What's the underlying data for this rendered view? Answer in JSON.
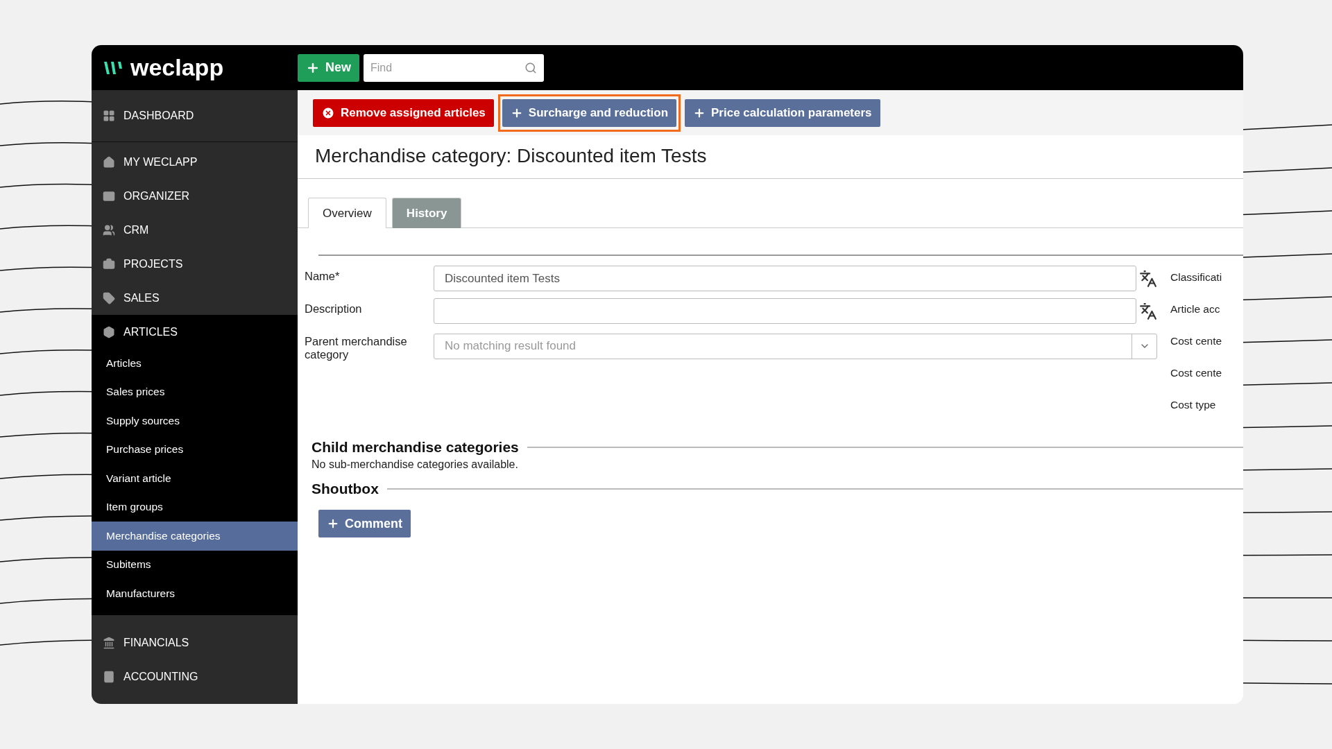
{
  "app": {
    "logo": "weclapp",
    "new_button": "New",
    "search": {
      "placeholder": "Find"
    }
  },
  "sidebar": {
    "items": [
      {
        "label": "DASHBOARD",
        "expanded": false
      },
      {
        "label": "MY WECLAPP",
        "expanded": false
      },
      {
        "label": "ORGANIZER",
        "expanded": false
      },
      {
        "label": "CRM",
        "expanded": false
      },
      {
        "label": "PROJECTS",
        "expanded": false
      },
      {
        "label": "SALES",
        "expanded": false
      },
      {
        "label": "ARTICLES",
        "expanded": true,
        "children": [
          {
            "label": "Articles",
            "selected": false
          },
          {
            "label": "Sales prices",
            "selected": false
          },
          {
            "label": "Supply sources",
            "selected": false
          },
          {
            "label": "Purchase prices",
            "selected": false
          },
          {
            "label": "Variant article",
            "selected": false
          },
          {
            "label": "Item groups",
            "selected": false
          },
          {
            "label": "Merchandise categories",
            "selected": true
          },
          {
            "label": "Subitems",
            "selected": false
          },
          {
            "label": "Manufacturers",
            "selected": false
          }
        ]
      },
      {
        "label": "FINANCIALS",
        "expanded": false
      },
      {
        "label": "ACCOUNTING",
        "expanded": false
      }
    ]
  },
  "toolbar": [
    {
      "label": "Remove assigned articles",
      "kind": "danger",
      "highlighted": false
    },
    {
      "label": "Surcharge and reduction",
      "kind": "add",
      "highlighted": true
    },
    {
      "label": "Price calculation parameters",
      "kind": "add",
      "highlighted": false
    }
  ],
  "page_title": "Merchandise category: Discounted item Tests",
  "tabs": [
    {
      "label": "Overview",
      "selected": true
    },
    {
      "label": "History",
      "selected": false
    }
  ],
  "form": {
    "fields": [
      {
        "label": "Name*",
        "kind": "translatable",
        "value": "Discounted item Tests"
      },
      {
        "label": "Description",
        "kind": "translatable"
      },
      {
        "label": "Parent merchandise category",
        "kind": "select",
        "placeholder": "No matching result found"
      }
    ],
    "side_labels": [
      "Classificati",
      "Article acc",
      "Cost cente",
      "Cost cente",
      "Cost type"
    ]
  },
  "child_categories": {
    "heading": "Child merchandise categories",
    "empty_text": "No sub-merchandise categories available."
  },
  "shoutbox": {
    "heading": "Shoutbox",
    "button": "Comment"
  }
}
